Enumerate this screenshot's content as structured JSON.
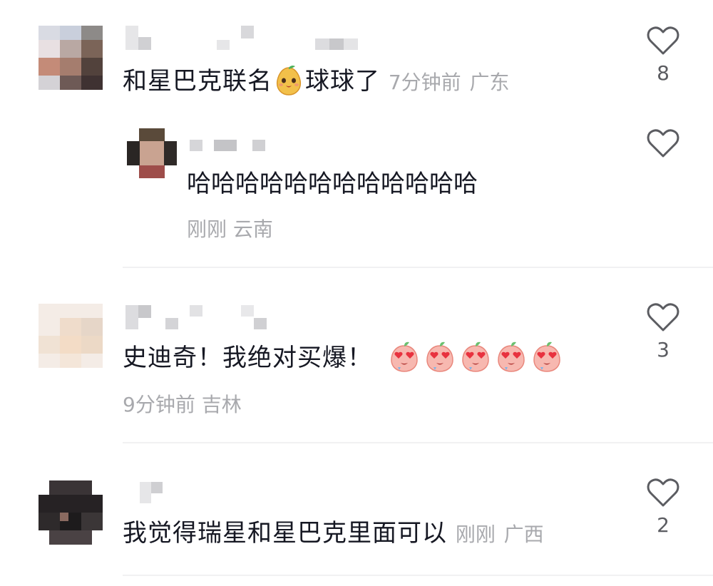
{
  "comments": [
    {
      "text": "和星巴克联名",
      "text_after_emoji": "球球了",
      "emoji": "pear-face-emoji",
      "time": "7分钟前",
      "region": "广东",
      "likes": "8",
      "replies": [
        {
          "text": "哈哈哈哈哈哈哈哈哈哈哈哈",
          "time": "刚刚",
          "region": "云南"
        }
      ]
    },
    {
      "text": "史迪奇！我绝对买爆！",
      "emoji": "heart-eyes-peach-emoji",
      "emoji_count": 5,
      "time": "9分钟前",
      "region": "吉林",
      "likes": "3"
    },
    {
      "text": "我觉得瑞星和星巴克里面可以",
      "time": "刚刚",
      "region": "广西",
      "likes": "2"
    }
  ],
  "colors": {
    "text": "#161823",
    "meta": "#a8a9ad",
    "divider": "#f1f1f2",
    "like_icon": "#5b5c61"
  }
}
